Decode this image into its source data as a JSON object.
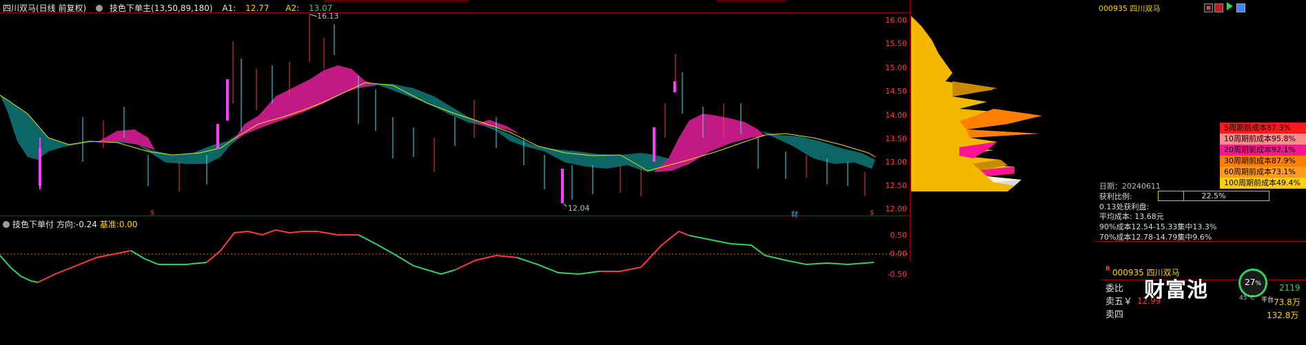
{
  "main_chart": {
    "stock_title": "四川双马(日线 前复权)",
    "indicator_name": "技色下单主(13,50,89,180)",
    "a1_label": "A1:",
    "a1_value": "12.77",
    "a2_label": "A2:",
    "a2_value": "13.07",
    "high_marker": "16.13",
    "low_marker": "12.04",
    "axis_ticks": [
      "16.00",
      "15.50",
      "15.00",
      "14.50",
      "14.00",
      "13.50",
      "13.00",
      "12.50",
      "12.00"
    ],
    "bottom_markers": [
      "$",
      "财",
      "$"
    ]
  },
  "sub_chart": {
    "indicator_name": "技色下单付",
    "direction_label": "方向:",
    "direction_value": "-0.24",
    "base_label": "基准:",
    "base_value": "0.00",
    "axis_ticks": [
      "0.50",
      "0.00",
      "-0.50"
    ]
  },
  "chip_panel": {
    "code_title": "000935 四川双马",
    "cost_rows": [
      {
        "label": "5周期前成本87.3%",
        "color": "#ff1a1a"
      },
      {
        "label": "10周期前成本95.8%",
        "color": "#ff8c8c"
      },
      {
        "label": "20周期前成本92.1%",
        "color": "#ff1493"
      },
      {
        "label": "30周期前成本87.9%",
        "color": "#ff7f00"
      },
      {
        "label": "60周期前成本73.1%",
        "color": "#ff9a1f"
      },
      {
        "label": "100周期前成本49.4%",
        "color": "#ffd000"
      }
    ],
    "date_line": "日期：20240611",
    "profit_label": "获利比例:",
    "profit_value": "22.5%",
    "profit_fill": 0.225,
    "profit_line": "0.13处获利盘:",
    "avg_cost": "平均成本: 13.68元",
    "cost90": "90%成本12.54-15.33集中13.3%",
    "cost70": "70%成本12.78-14.79集中9.6%"
  },
  "quote_panel": {
    "badge": "R",
    "code_name": "000935 四川双马",
    "rows": [
      {
        "label": "委比",
        "value": "",
        "right": "2119"
      },
      {
        "label": "卖五￥",
        "value": "12.99",
        "right": "73.8万"
      },
      {
        "label": "卖四",
        "value": "",
        "right": "132.8万"
      }
    ]
  },
  "watermark": {
    "text": "财富池",
    "badge_percent": "27",
    "badge_unit": "%",
    "badge_sub": "45°C",
    "badge_sub2": "平台"
  },
  "colors": {
    "axis_red": "#ff3b3b",
    "magenta_fill": "#c21a85",
    "teal_fill": "#0e6b6b",
    "candle_up": "#ff3b3b",
    "candle_down": "#3fe7f3",
    "line_green": "#2fd35f",
    "line_red": "#ff3b3b",
    "chip_yellow": "#f5b800"
  }
}
